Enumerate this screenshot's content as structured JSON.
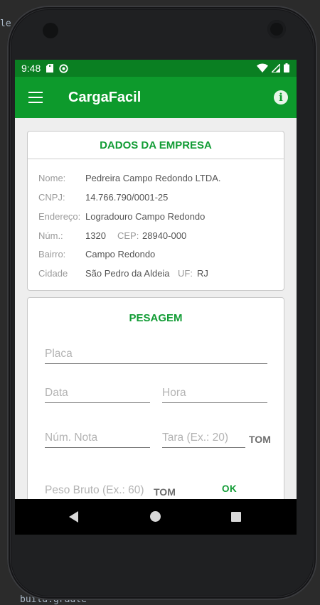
{
  "ide": {
    "left_fragment": "le",
    "bottom_fragment": "build.gradle"
  },
  "status_bar": {
    "time": "9:48"
  },
  "app_bar": {
    "title": "CargaFacil",
    "info_symbol": "i"
  },
  "empresa": {
    "title": "DADOS DA EMPRESA",
    "nome_label": "Nome:",
    "nome": "Pedreira Campo Redondo LTDA.",
    "cnpj_label": "CNPJ:",
    "cnpj": "14.766.790/0001-25",
    "endereco_label": "Endereço:",
    "endereco": "Logradouro Campo Redondo",
    "num_label": "Núm.:",
    "num": "1320",
    "cep_label": "CEP:",
    "cep": "28940-000",
    "bairro_label": "Bairro:",
    "bairro": "Campo Redondo",
    "cidade_label": "Cidade",
    "cidade": "São Pedro da Aldeia",
    "uf_label": "UF:",
    "uf": "RJ"
  },
  "pesagem": {
    "title": "PESAGEM",
    "placa_placeholder": "Placa",
    "data_placeholder": "Data",
    "hora_placeholder": "Hora",
    "nota_placeholder": "Núm. Nota",
    "tara_placeholder": "Tara (Ex.: 20)",
    "tara_unit": "TOM",
    "peso_placeholder": "Peso Bruto (Ex.: 60)",
    "peso_unit": "TOM",
    "ok_label": "OK"
  },
  "colors": {
    "status_bar": "#0a7f22",
    "app_bar": "#0d9a2c",
    "accent": "#129c35"
  },
  "icons": [
    "menu-icon",
    "info-icon",
    "sd-card-icon",
    "sync-icon",
    "wifi-icon",
    "signal-icon",
    "battery-icon",
    "back-icon",
    "home-icon",
    "recents-icon"
  ]
}
